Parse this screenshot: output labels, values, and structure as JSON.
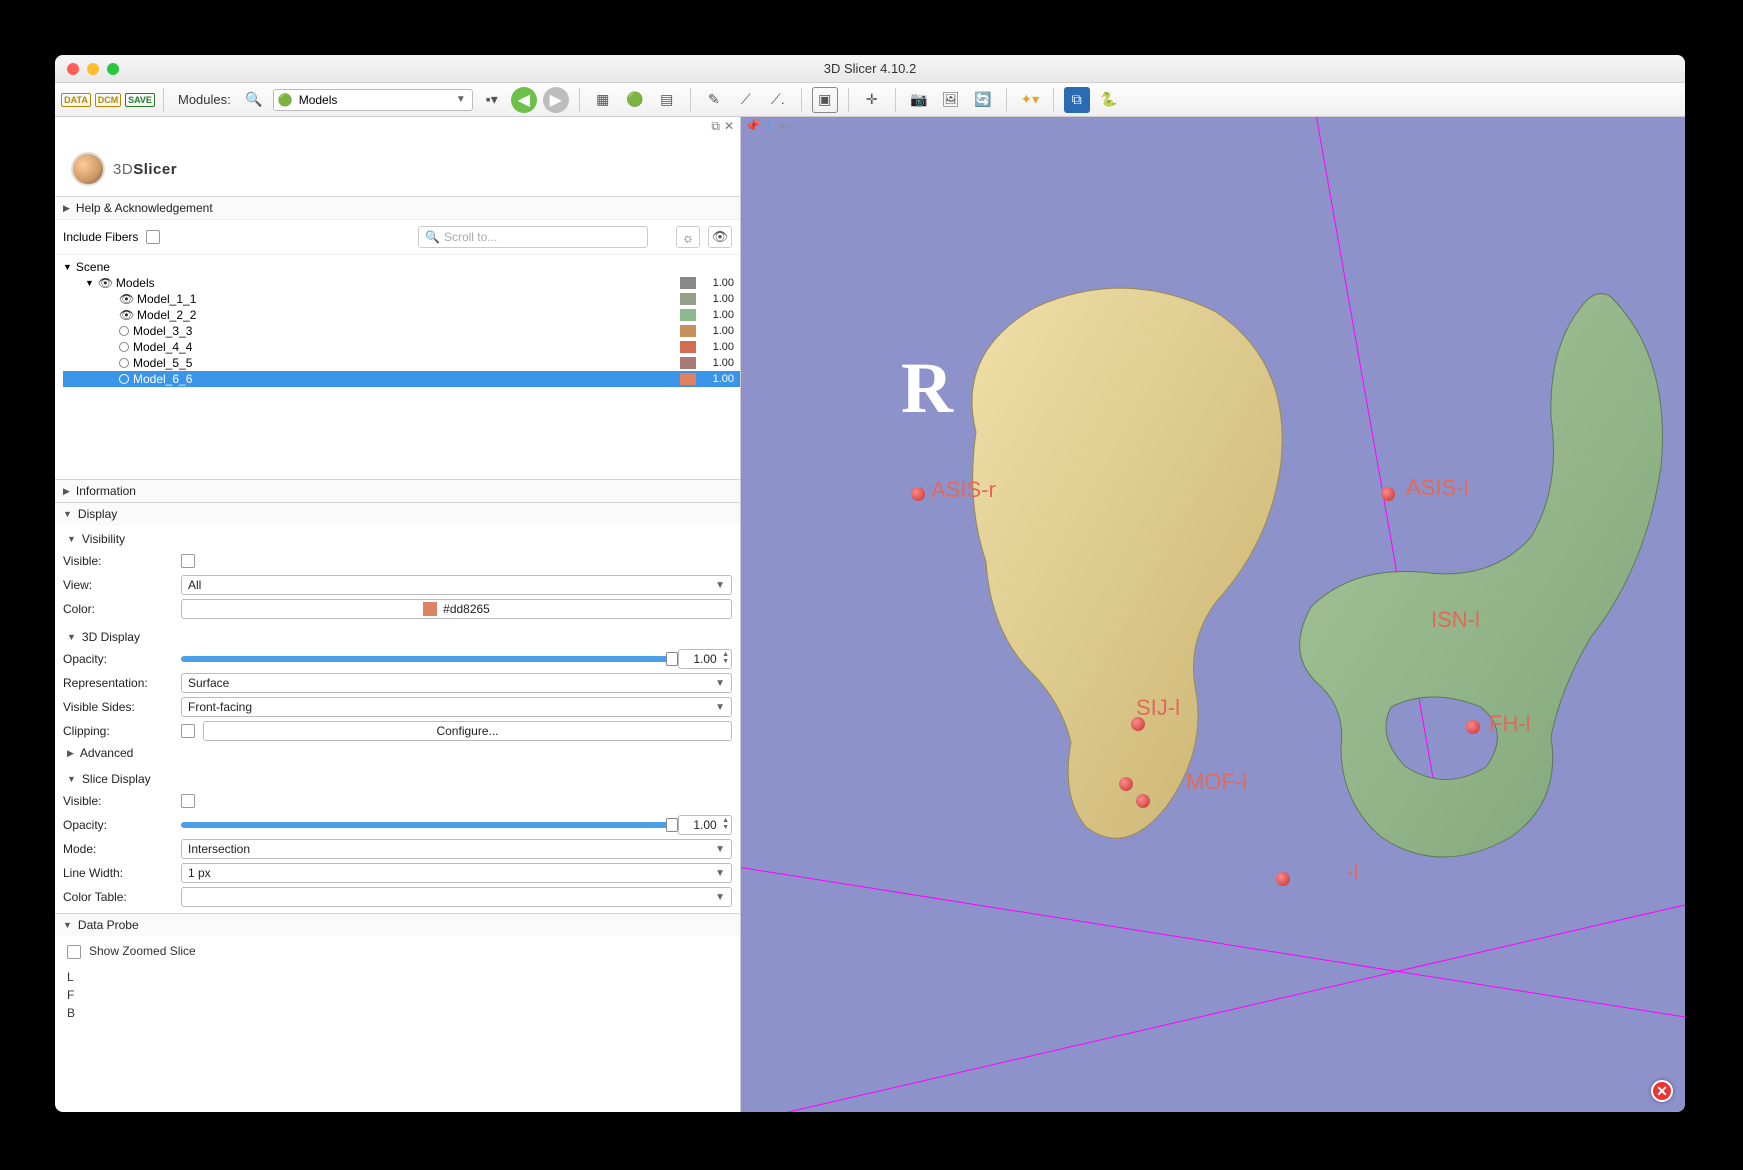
{
  "window": {
    "title": "3D Slicer 4.10.2"
  },
  "toolbar": {
    "data_label": "DATA",
    "dcm_label": "DCM",
    "save_label": "SAVE",
    "modules_label": "Modules:",
    "module_selected": "Models"
  },
  "logo": {
    "text_prefix": "3D",
    "text_suffix": "Slicer"
  },
  "sections": {
    "help": "Help & Acknowledgement",
    "information": "Information",
    "display": "Display",
    "visibility": "Visibility",
    "threeD": "3D Display",
    "advanced": "Advanced",
    "slice": "Slice Display",
    "dataprobe": "Data Probe"
  },
  "fibers": {
    "label": "Include Fibers",
    "scroll_placeholder": "Scroll to..."
  },
  "tree": {
    "root": "Scene",
    "models": "Models",
    "items": [
      {
        "name": "Model_1_1",
        "color": "#96a089",
        "value": "1.00",
        "visible": true
      },
      {
        "name": "Model_2_2",
        "color": "#8cb88b",
        "value": "1.00",
        "visible": true
      },
      {
        "name": "Model_3_3",
        "color": "#c5915f",
        "value": "1.00",
        "visible": false
      },
      {
        "name": "Model_4_4",
        "color": "#d36b55",
        "value": "1.00",
        "visible": false
      },
      {
        "name": "Model_5_5",
        "color": "#a97a75",
        "value": "1.00",
        "visible": false
      },
      {
        "name": "Model_6_6",
        "color": "#dd8265",
        "value": "1.00",
        "visible": false,
        "selected": true
      }
    ]
  },
  "visibility": {
    "visible_label": "Visible:",
    "view_label": "View:",
    "view_value": "All",
    "color_label": "Color:",
    "color_hex": "#dd8265"
  },
  "threeD": {
    "opacity_label": "Opacity:",
    "opacity_value": "1.00",
    "repr_label": "Representation:",
    "repr_value": "Surface",
    "sides_label": "Visible Sides:",
    "sides_value": "Front-facing",
    "clip_label": "Clipping:",
    "configure": "Configure..."
  },
  "slice": {
    "visible_label": "Visible:",
    "opacity_label": "Opacity:",
    "opacity_value": "1.00",
    "mode_label": "Mode:",
    "mode_value": "Intersection",
    "lw_label": "Line Width:",
    "lw_value": "1 px",
    "ct_label": "Color Table:"
  },
  "dataprobe": {
    "zoom": "Show Zoomed Slice",
    "L": "L",
    "F": "F",
    "B": "B"
  },
  "view3d": {
    "orientation": "R",
    "pin": "📌",
    "num": "1",
    "labels": [
      "ASIS-r",
      "ASIS-l",
      "ISN-l",
      "SIJ-l",
      "FH-l",
      "MOF-l",
      "-l"
    ]
  }
}
